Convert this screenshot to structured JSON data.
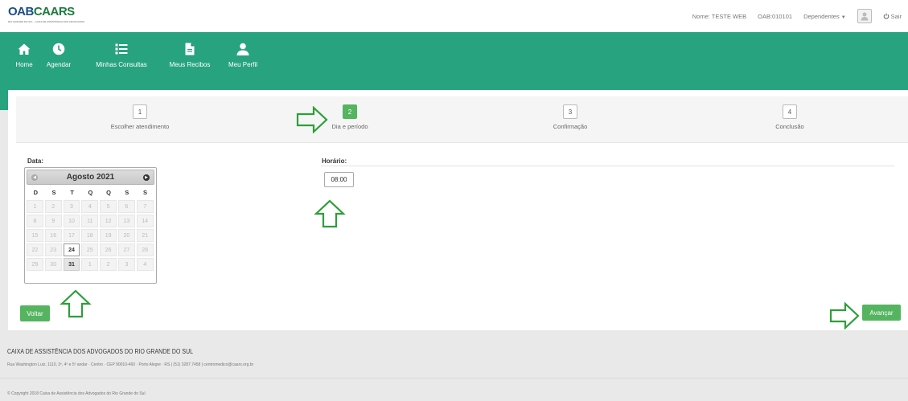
{
  "brand": {
    "name_oab": "OAB",
    "name_rest": "CAARS",
    "tagline": "RIO GRANDE DO SUL · CAIXA DE ASSISTÊNCIA DOS ADVOGADOS"
  },
  "header": {
    "user_name": "Nome: TESTE WEB",
    "oab_number": "OAB:010101",
    "dependents_label": "Dependentes",
    "logout_label": "Sair"
  },
  "nav": {
    "items": [
      {
        "label": "Home",
        "icon": "home-icon"
      },
      {
        "label": "Agendar",
        "icon": "clock-icon"
      },
      {
        "label": "Minhas Consultas",
        "icon": "list-icon"
      },
      {
        "label": "Meus Recibos",
        "icon": "document-icon"
      },
      {
        "label": "Meu Perfil",
        "icon": "user-icon"
      }
    ]
  },
  "steps": [
    {
      "num": "1",
      "label": "Escolher atendimento",
      "active": false
    },
    {
      "num": "2",
      "label": "Dia e período",
      "active": true
    },
    {
      "num": "3",
      "label": "Confirmação",
      "active": false
    },
    {
      "num": "4",
      "label": "Conclusão",
      "active": false
    }
  ],
  "form": {
    "date_label": "Data:",
    "time_label": "Horário:",
    "time_slot": "08:00"
  },
  "calendar": {
    "title": "Agosto 2021",
    "weekdays": [
      "D",
      "S",
      "T",
      "Q",
      "Q",
      "S",
      "S"
    ],
    "weeks": [
      [
        "1",
        "2",
        "3",
        "4",
        "5",
        "6",
        "7"
      ],
      [
        "8",
        "9",
        "10",
        "11",
        "12",
        "13",
        "14"
      ],
      [
        "15",
        "16",
        "17",
        "18",
        "19",
        "20",
        "21"
      ],
      [
        "22",
        "23",
        "24",
        "25",
        "26",
        "27",
        "28"
      ],
      [
        "29",
        "30",
        "31",
        "1",
        "2",
        "3",
        "4"
      ]
    ],
    "selected_day": "24",
    "highlighted_day": "31"
  },
  "buttons": {
    "back": "Voltar",
    "next": "Avançar"
  },
  "footer": {
    "org_name": "CAIXA DE ASSISTÊNCIA DOS ADVOGADOS DO RIO GRANDE DO SUL",
    "address": "Rua Washington Luiz, 1110, 3º, 4º e 5º andar · Centro · CEP 90010-460 · Porto Alegre · RS | (51) 3287.7458 | centromedico@caars.org.br",
    "copyright": "© Copyright 2018 Caixa de Assistência dos Advogados do Rio Grande do Sul"
  },
  "colors": {
    "primary": "#28a37f",
    "button": "#55b460",
    "arrow": "#2e9e3a"
  }
}
